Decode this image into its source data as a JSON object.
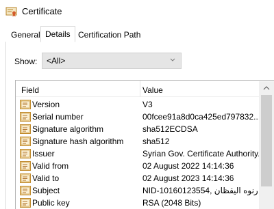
{
  "window": {
    "title": "Certificate",
    "icon": "certificate-icon"
  },
  "tabs": [
    {
      "label": "General"
    },
    {
      "label": "Details",
      "selected": true
    },
    {
      "label": "Certification Path"
    }
  ],
  "show": {
    "label": "Show:",
    "selected": "<All>",
    "icon": "chevron-down-icon"
  },
  "list": {
    "columns": {
      "field": "Field",
      "value": "Value"
    },
    "rows": [
      {
        "field": "Version",
        "value": "V3"
      },
      {
        "field": "Serial number",
        "value": "00fcee91a8d0ca425ed797832..."
      },
      {
        "field": "Signature algorithm",
        "value": "sha512ECDSA"
      },
      {
        "field": "Signature hash algorithm",
        "value": "sha512"
      },
      {
        "field": "Issuer",
        "value": "Syrian Gov. Certificate Authority..."
      },
      {
        "field": "Valid from",
        "value": "02 August 2022 14:14:36"
      },
      {
        "field": "Valid to",
        "value": "02 August 2023 14:14:36"
      },
      {
        "field": "Subject",
        "value": "NID-10160123554, رنوه اليقظان ..."
      },
      {
        "field": "Public key",
        "value": "RSA (2048 Bits)"
      }
    ],
    "row_icon": "certificate-field-icon"
  },
  "colors": {
    "accent": "#0078d7",
    "tab_border": "#d9d9d9",
    "select_bg": "#e5e5e5",
    "scroll_thumb": "#cdcdcd"
  }
}
